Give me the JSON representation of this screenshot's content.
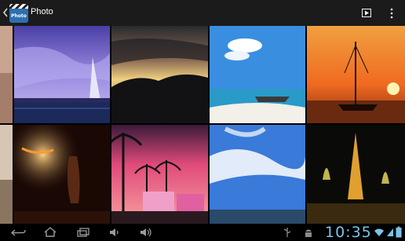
{
  "app": {
    "title": "Photo",
    "icon_text": "Photo"
  },
  "toolbar": {
    "back_icon": "chevron-left-icon",
    "slideshow_icon": "play-icon",
    "overflow_icon": "more-vertical-icon"
  },
  "gallery": {
    "photos": [
      "purple-sky-bridge",
      "sunset-silhouette-hills",
      "beach-boat-blue-sky",
      "sailboat-orange-sunset",
      "fire-dancer-night",
      "palm-trees-pink-sky",
      "blue-sky-clouds",
      "eiffel-tower-fountains"
    ]
  },
  "status": {
    "time": "10:35"
  },
  "colors": {
    "clock": "#7cc4e8",
    "action_bar": "#1b1b1b"
  }
}
